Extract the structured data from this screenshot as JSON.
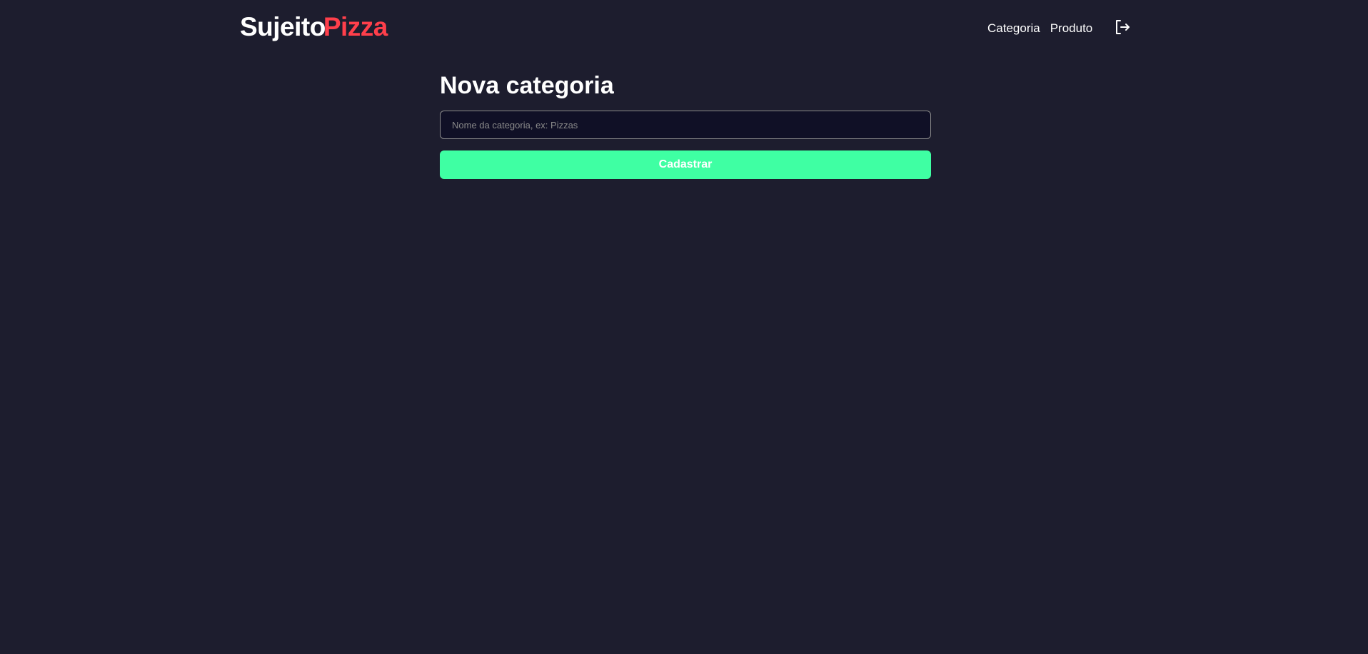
{
  "header": {
    "logo": {
      "part1": "Sujeito",
      "part2": "Pizza"
    },
    "nav": {
      "category_label": "Categoria",
      "product_label": "Produto"
    },
    "logout_icon": "logout-icon"
  },
  "main": {
    "title": "Nova categoria",
    "category_input": {
      "value": "",
      "placeholder": "Nome da categoria, ex: Pizzas"
    },
    "submit_label": "Cadastrar"
  },
  "colors": {
    "background": "#1d1d2e",
    "input_background": "#101026",
    "input_border": "#8a8a8a",
    "accent_red": "#ff3f4b",
    "accent_green": "#3fffa3",
    "text": "#ffffff"
  }
}
